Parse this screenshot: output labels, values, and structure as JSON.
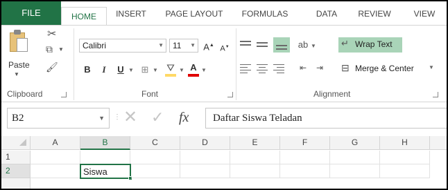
{
  "tabs": {
    "file": "FILE",
    "home": "HOME",
    "insert": "INSERT",
    "page_layout": "PAGE LAYOUT",
    "formulas": "FORMULAS",
    "data": "DATA",
    "review": "REVIEW",
    "view": "VIEW"
  },
  "clipboard": {
    "paste_label": "Paste",
    "group_label": "Clipboard"
  },
  "font": {
    "font_name": "Calibri",
    "font_size": "11",
    "bold": "B",
    "italic": "I",
    "underline": "U",
    "grow": "A",
    "shrink": "A",
    "font_color": "A",
    "group_label": "Font"
  },
  "alignment": {
    "wrap_text": "Wrap Text",
    "merge_center": "Merge & Center",
    "group_label": "Alignment"
  },
  "formula_bar": {
    "name_box": "B2",
    "fx": "fx",
    "content": "Daftar Siswa Teladan"
  },
  "grid": {
    "columns": [
      "A",
      "B",
      "C",
      "D",
      "E",
      "F",
      "G",
      "H"
    ],
    "rows": [
      "1",
      "2"
    ],
    "cell_b2": "Siswa"
  },
  "colors": {
    "accent": "#217346",
    "highlight": "#a9d4b8"
  }
}
